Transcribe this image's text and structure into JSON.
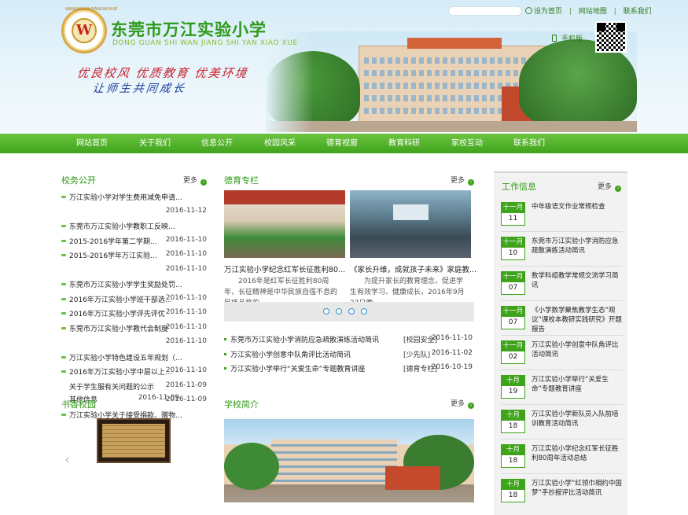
{
  "header": {
    "title": "东莞市万江实验小学",
    "pinyin": "DONG GUAN SHI WAN JIANG SHI YAN XIAO XUE",
    "slogan_line1": "优良校风 优质教育 优美环境",
    "slogan_line2": "让师生共同成长",
    "logo_letter": "W",
    "logo_ring_text": "WANJIANGSHIYANXIAOXUE",
    "toplinks": [
      "设为首页",
      "网站地图",
      "联系我们"
    ],
    "mobile_label": "手机版"
  },
  "nav": [
    "网站首页",
    "关于我们",
    "信息公开",
    "校园风采",
    "德育视窗",
    "教育科研",
    "家校互动",
    "联系我们"
  ],
  "more_label": "更多",
  "xiaowu": {
    "title": "校务公开",
    "items": [
      {
        "text": "万江实验小学对学生费用减免申请...",
        "date": ""
      },
      {
        "text": "",
        "date": "2016-11-12"
      },
      {
        "text": "东莞市万江实验小学教职工反映...",
        "date": ""
      },
      {
        "text": "2015-2016学年第二学期...",
        "date": "2016-11-10"
      },
      {
        "text": "2015-2016学年万江实验...",
        "date": "2016-11-10"
      },
      {
        "text": "",
        "date": "2016-11-10"
      },
      {
        "text": "东莞市万江实验小学学生奖励处罚...",
        "date": ""
      },
      {
        "text": "2016年万江实验小学班干部选...",
        "date": "2016-11-10"
      },
      {
        "text": "2016年万江实验小学评先评优",
        "date": "2016-11-10"
      },
      {
        "text": "东莞市万江实验小学教代会制度",
        "date": "2016-11-10"
      },
      {
        "text": "",
        "date": "2016-11-10"
      },
      {
        "text": "万江实验小学特色建设五年规划（...",
        "date": ""
      },
      {
        "text": "2016年万江实验小学中层以上...",
        "date": "2016-11-10"
      },
      {
        "text": "关于学生服有关问题的公示",
        "date": "2016-11-09"
      },
      {
        "text": "其他信息",
        "date": "2016-11-09"
      },
      {
        "text": "万江实验小学关于接受捐款、赠物...",
        "date": ""
      }
    ],
    "overlap_date": "2016-11-09"
  },
  "shuxiang": {
    "title": "书香校园"
  },
  "deyu": {
    "title": "德育专栏",
    "photos": [
      {
        "caption": "万江实验小学纪念红军长征胜利80...",
        "desc": "2016年是红军长征胜利80周年，长征精神是中华民族自强不息的民族品格的"
      },
      {
        "caption": "《家长升维，成就孩子未来》家庭教...",
        "desc": "为提升家长的教育理念，促进学生有效学习、健康成长，2016年9月27日晚"
      }
    ],
    "list": [
      {
        "text": "东莞市万江实验小学消防应急疏散演练活动简讯",
        "cat": "[校园安全]",
        "date": "2016-11-10"
      },
      {
        "text": "万江实验小学创意中队角评比活动简讯",
        "cat": "[少先队]",
        "date": "2016-11-02"
      },
      {
        "text": "万江实验小学举行“关爱生命”专题教育讲座",
        "cat": "[德育专栏]",
        "date": "2016-10-19"
      }
    ]
  },
  "intro": {
    "title": "学校简介"
  },
  "work": {
    "title": "工作信息",
    "items": [
      {
        "mon": "十一月",
        "day": "11",
        "text": "中年级语文作业常规检查"
      },
      {
        "mon": "十一月",
        "day": "10",
        "text": "东莞市万江实验小学消防应急疏散演练活动简讯"
      },
      {
        "mon": "十一月",
        "day": "07",
        "text": "数学科组教学常规交流学习简讯"
      },
      {
        "mon": "十一月",
        "day": "07",
        "text": "《小学数学聚焦教学生态“观议”课校本教研实践研究》开题报告"
      },
      {
        "mon": "十一月",
        "day": "02",
        "text": "万江实验小学创意中队角评比活动简讯"
      },
      {
        "mon": "十月",
        "day": "19",
        "text": "万江实验小学举行“关爱生命”专题教育讲座"
      },
      {
        "mon": "十月",
        "day": "18",
        "text": "万江实验小学新队员入队前培训教育活动简讯"
      },
      {
        "mon": "十月",
        "day": "18",
        "text": "万江实验小学纪念红军长征胜利80周年活动总结"
      },
      {
        "mon": "十月",
        "day": "18",
        "text": "万江实验小学“红领巾相约中国梦”手抄报评比活动简讯"
      }
    ]
  },
  "colors": {
    "brand_green": "#3fa31b",
    "title_green": "#2e9a1a",
    "slogan_red": "#c8202c",
    "slogan_blue": "#1a3d9a"
  }
}
